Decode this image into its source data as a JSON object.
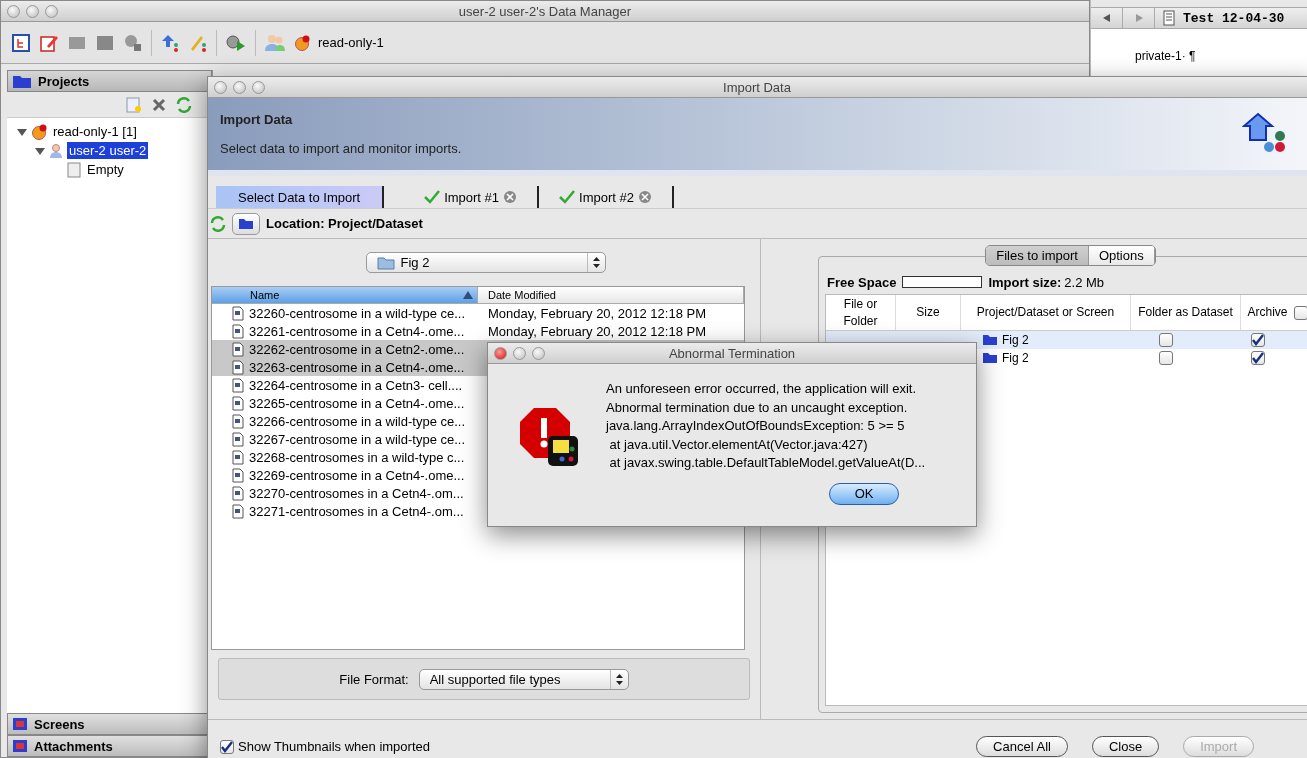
{
  "main_window": {
    "title": "user-2 user-2's Data Manager",
    "toolbar_label": "read-only-1",
    "projects_panel": {
      "title": "Projects",
      "tree": [
        {
          "label": "read-only-1 [1]",
          "kind": "group",
          "expanded": true,
          "selected": false,
          "children": [
            {
              "label": "user-2 user-2",
              "kind": "user",
              "expanded": true,
              "selected": true,
              "children": [
                {
                  "label": "Empty",
                  "kind": "dataset",
                  "selected": false
                }
              ]
            }
          ]
        }
      ]
    },
    "bottom_panels": [
      "Screens",
      "Attachments"
    ]
  },
  "side_window": {
    "title": "Test 12-04-30",
    "lines": [
      "private-1· ¶"
    ]
  },
  "import_dialog": {
    "title": "Import Data",
    "header_title": "Import Data",
    "header_subtitle": "Select data to import and monitor imports.",
    "tabs": [
      {
        "label": "Select Data to Import",
        "selected": true,
        "done": false,
        "closable": false
      },
      {
        "label": "Import #1",
        "selected": false,
        "done": true,
        "closable": true
      },
      {
        "label": "Import #2",
        "selected": false,
        "done": true,
        "closable": true
      }
    ],
    "location": "Location: Project/Dataset",
    "folder": "Fig 2",
    "file_columns": [
      "Name",
      "Date Modified"
    ],
    "files": [
      {
        "name": "32260-centrosome in a wild-type ce...",
        "date": "Monday, February 20, 2012 12:18 PM",
        "selected": false
      },
      {
        "name": "32261-centrosome in a Cetn4-.ome...",
        "date": "Monday, February 20, 2012 12:18 PM",
        "selected": false
      },
      {
        "name": "32262-centrosome in a Cetn2-.ome...",
        "selected": true
      },
      {
        "name": "32263-centrosome in a Cetn4-.ome...",
        "selected": true
      },
      {
        "name": "32264-centrosome in a Cetn3- cell....",
        "selected": false
      },
      {
        "name": "32265-centrosome in a Cetn4-.ome...",
        "selected": false
      },
      {
        "name": "32266-centrosome in a wild-type ce...",
        "selected": false
      },
      {
        "name": "32267-centrosome in a wild-type ce...",
        "selected": false
      },
      {
        "name": "32268-centrosomes in a wild-type c...",
        "selected": false
      },
      {
        "name": "32269-centrosome in a Cetn4-.ome...",
        "selected": false
      },
      {
        "name": "32270-centrosomes in a Cetn4-.om...",
        "selected": false
      },
      {
        "name": "32271-centrosomes in a Cetn4-.om...",
        "selected": false
      }
    ],
    "file_format_label": "File Format:",
    "file_format": "All supported file types",
    "right_tabs": [
      {
        "label": "Files to import",
        "selected": true
      },
      {
        "label": "Options",
        "selected": false
      }
    ],
    "free_space_label": "Free Space",
    "import_size_label": "Import size:",
    "import_size": "2.2 Mb",
    "queue_columns": [
      "File or Folder",
      "Size",
      "Project/Dataset or Screen",
      "Folder as Dataset",
      "Archive"
    ],
    "archive_all": false,
    "queue": [
      {
        "project": "Fig 2",
        "folder_as_dataset": false,
        "archive": true,
        "selected": true
      },
      {
        "project": "Fig 2",
        "folder_as_dataset": false,
        "archive": true,
        "selected": false
      }
    ],
    "show_thumbnails": {
      "label": "Show Thumbnails when imported",
      "checked": true
    },
    "buttons": [
      {
        "label": "Cancel All",
        "disabled": false
      },
      {
        "label": "Close",
        "disabled": false
      },
      {
        "label": "Import",
        "disabled": true
      }
    ]
  },
  "error_dialog": {
    "title": "Abnormal Termination",
    "lines": [
      "An unforeseen error occurred, the application will exit.",
      "Abnormal termination due to an uncaught exception.",
      "java.lang.ArrayIndexOutOfBoundsException: 5 >= 5",
      " at java.util.Vector.elementAt(Vector.java:427)",
      " at javax.swing.table.DefaultTableModel.getValueAt(D..."
    ],
    "button": "OK"
  }
}
